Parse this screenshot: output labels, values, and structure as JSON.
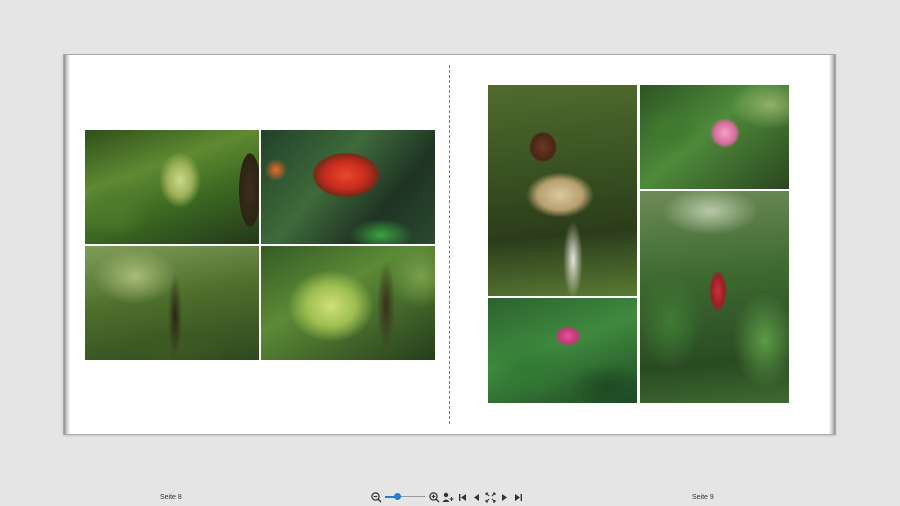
{
  "book": {
    "left_page_label": "Seite 8",
    "right_page_label": "Seite 9",
    "left_photos": [
      "tropical-forest-bromeliads",
      "red-bromeliad",
      "rainforest-trees",
      "palm-fronds"
    ],
    "right_photos": [
      "hanging-flower",
      "pink-flower",
      "pink-flower-cluster",
      "red-heliconia"
    ]
  },
  "toolbar": {
    "zoom_level": 0.3,
    "icons": [
      "zoom-out-icon",
      "zoom-in-icon",
      "add-person-icon",
      "first-page-icon",
      "previous-page-icon",
      "fit-page-icon",
      "next-page-icon",
      "last-page-icon"
    ],
    "accent_color": "#1f7fd6"
  },
  "colors": {
    "background": "#e5e5e5",
    "page": "#fefefe"
  }
}
